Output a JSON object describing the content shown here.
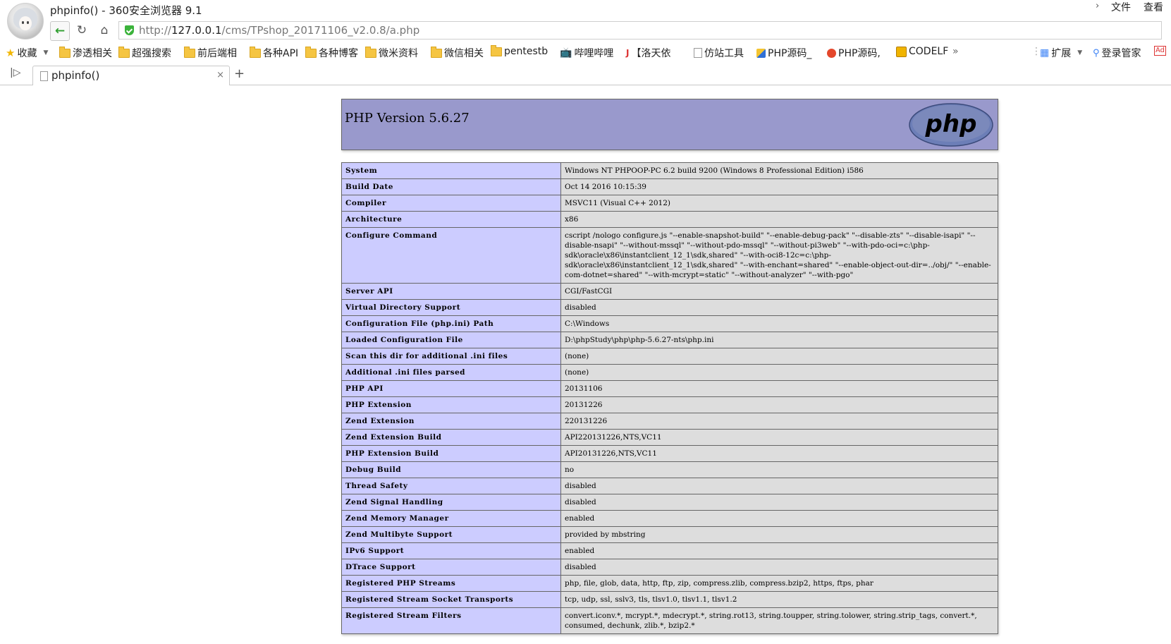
{
  "window": {
    "title": "phpinfo() - 360安全浏览器 9.1",
    "menu": [
      "文件",
      "查看"
    ]
  },
  "address": {
    "url_prefix": "http://",
    "url_host": "127.0.0.1",
    "url_path": "/cms/TPshop_20171106_v2.0.8/a.php"
  },
  "bookmarks": [
    {
      "label": "收藏",
      "icon": "star-icon"
    },
    {
      "label": "渗透相关",
      "icon": "folder-icon"
    },
    {
      "label": "超强搜索",
      "icon": "folder-icon"
    },
    {
      "label": "前后端相",
      "icon": "folder-icon"
    },
    {
      "label": "各种API",
      "icon": "folder-icon"
    },
    {
      "label": "各种博客",
      "icon": "folder-icon"
    },
    {
      "label": "微米资料",
      "icon": "folder-icon"
    },
    {
      "label": "微信相关",
      "icon": "folder-icon"
    },
    {
      "label": "pentestb",
      "icon": "folder-icon"
    },
    {
      "label": "哔哩哔哩",
      "icon": "bilibili-icon"
    },
    {
      "label": "【洛天依",
      "icon": "page-icon"
    },
    {
      "label": "仿站工具",
      "icon": "page-icon"
    },
    {
      "label": "PHP源码_",
      "icon": "site-icon"
    },
    {
      "label": "PHP源码,",
      "icon": "site-icon"
    },
    {
      "label": "CODELF",
      "icon": "site-icon"
    },
    {
      "label": "»",
      "icon": ""
    },
    {
      "label": "扩展",
      "icon": "grid-icon"
    },
    {
      "label": "登录管家",
      "icon": "search-key-icon"
    },
    {
      "label": "Ad",
      "icon": "ad-icon"
    }
  ],
  "tab": {
    "label": "phpinfo()",
    "close": "×",
    "new": "+"
  },
  "php": {
    "version": "PHP Version 5.6.27",
    "logo_text": "php",
    "rows": [
      {
        "k": "System",
        "v": "Windows NT PHPOOP-PC 6.2 build 9200 (Windows 8 Professional Edition) i586"
      },
      {
        "k": "Build Date",
        "v": "Oct 14 2016 10:15:39"
      },
      {
        "k": "Compiler",
        "v": "MSVC11 (Visual C++ 2012)"
      },
      {
        "k": "Architecture",
        "v": "x86"
      },
      {
        "k": "Configure Command",
        "v": "cscript /nologo configure.js \"--enable-snapshot-build\" \"--enable-debug-pack\" \"--disable-zts\" \"--disable-isapi\" \"--disable-nsapi\" \"--without-mssql\" \"--without-pdo-mssql\" \"--without-pi3web\" \"--with-pdo-oci=c:\\php-sdk\\oracle\\x86\\instantclient_12_1\\sdk,shared\" \"--with-oci8-12c=c:\\php-sdk\\oracle\\x86\\instantclient_12_1\\sdk,shared\" \"--with-enchant=shared\" \"--enable-object-out-dir=../obj/\" \"--enable-com-dotnet=shared\" \"--with-mcrypt=static\" \"--without-analyzer\" \"--with-pgo\""
      },
      {
        "k": "Server API",
        "v": "CGI/FastCGI"
      },
      {
        "k": "Virtual Directory Support",
        "v": "disabled"
      },
      {
        "k": "Configuration File (php.ini) Path",
        "v": "C:\\Windows"
      },
      {
        "k": "Loaded Configuration File",
        "v": "D:\\phpStudy\\php\\php-5.6.27-nts\\php.ini"
      },
      {
        "k": "Scan this dir for additional .ini files",
        "v": "(none)"
      },
      {
        "k": "Additional .ini files parsed",
        "v": "(none)"
      },
      {
        "k": "PHP API",
        "v": "20131106"
      },
      {
        "k": "PHP Extension",
        "v": "20131226"
      },
      {
        "k": "Zend Extension",
        "v": "220131226"
      },
      {
        "k": "Zend Extension Build",
        "v": "API220131226,NTS,VC11"
      },
      {
        "k": "PHP Extension Build",
        "v": "API20131226,NTS,VC11"
      },
      {
        "k": "Debug Build",
        "v": "no"
      },
      {
        "k": "Thread Safety",
        "v": "disabled"
      },
      {
        "k": "Zend Signal Handling",
        "v": "disabled"
      },
      {
        "k": "Zend Memory Manager",
        "v": "enabled"
      },
      {
        "k": "Zend Multibyte Support",
        "v": "provided by mbstring"
      },
      {
        "k": "IPv6 Support",
        "v": "enabled"
      },
      {
        "k": "DTrace Support",
        "v": "disabled"
      },
      {
        "k": "Registered PHP Streams",
        "v": "php, file, glob, data, http, ftp, zip, compress.zlib, compress.bzip2, https, ftps, phar"
      },
      {
        "k": "Registered Stream Socket Transports",
        "v": "tcp, udp, ssl, sslv3, tls, tlsv1.0, tlsv1.1, tlsv1.2"
      },
      {
        "k": "Registered Stream Filters",
        "v": "convert.iconv.*, mcrypt.*, mdecrypt.*, string.rot13, string.toupper, string.tolower, string.strip_tags, convert.*, consumed, dechunk, zlib.*, bzip2.*"
      }
    ]
  }
}
